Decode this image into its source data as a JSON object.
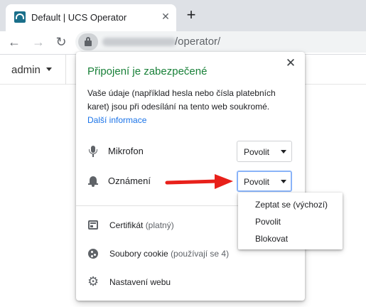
{
  "browser": {
    "tab": {
      "title": "Default | UCS Operator",
      "close_glyph": "✕"
    },
    "new_tab_glyph": "+",
    "nav": {
      "back_glyph": "←",
      "forward_glyph": "→",
      "reload_glyph": "↻"
    },
    "address": {
      "path": "/operator/"
    }
  },
  "page": {
    "user_menu": {
      "label": "admin"
    }
  },
  "site_info": {
    "title": "Připojení je zabezpečené",
    "close_glyph": "✕",
    "description": "Vaše údaje (například hesla nebo čísla platebních karet) jsou při odesílání na tento web soukromé.",
    "learn_more": "Další informace",
    "permissions": [
      {
        "label": "Mikrofon",
        "value": "Povolit",
        "icon": "microphone-icon"
      },
      {
        "label": "Oznámení",
        "value": "Povolit",
        "icon": "bell-icon"
      }
    ],
    "links": {
      "certificate": {
        "label": "Certifikát",
        "detail": "(platný)",
        "icon": "certificate-icon"
      },
      "cookies": {
        "label": "Soubory cookie",
        "detail": "(používají se 4)",
        "icon": "cookie-icon"
      },
      "site_settings": {
        "label": "Nastavení webu",
        "icon": "gear-icon"
      }
    }
  },
  "dropdown": {
    "options": [
      "Zeptat se (výchozí)",
      "Povolit",
      "Blokovat"
    ]
  },
  "colors": {
    "secure_green": "#188038",
    "link_blue": "#1a73e8",
    "annotation_red": "#e8201a"
  }
}
